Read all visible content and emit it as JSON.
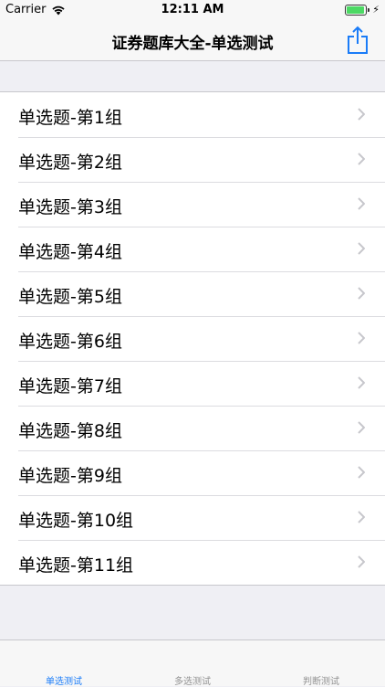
{
  "status_bar": {
    "carrier": "Carrier",
    "time": "12:11 AM",
    "battery_level": 1.0
  },
  "nav": {
    "title": "证券题库大全-单选测试",
    "share_icon": "share-icon"
  },
  "list": {
    "items": [
      {
        "label": "单选题-第1组"
      },
      {
        "label": "单选题-第2组"
      },
      {
        "label": "单选题-第3组"
      },
      {
        "label": "单选题-第4组"
      },
      {
        "label": "单选题-第5组"
      },
      {
        "label": "单选题-第6组"
      },
      {
        "label": "单选题-第7组"
      },
      {
        "label": "单选题-第8组"
      },
      {
        "label": "单选题-第9组"
      },
      {
        "label": "单选题-第10组"
      },
      {
        "label": "单选题-第11组"
      }
    ]
  },
  "tabs": [
    {
      "label": "单选测试",
      "active": true
    },
    {
      "label": "多选测试",
      "active": false
    },
    {
      "label": "判断测试",
      "active": false
    }
  ],
  "colors": {
    "accent": "#1a7cf8",
    "tab_inactive": "#929292",
    "battery": "#4cd964"
  }
}
